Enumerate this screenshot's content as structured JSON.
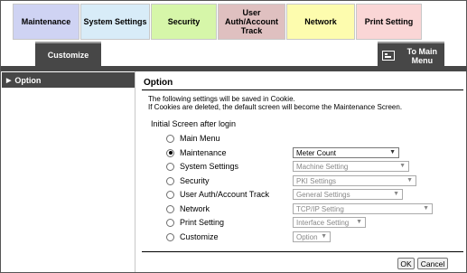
{
  "tabs": {
    "maintenance": "Maintenance",
    "system_settings": "System Settings",
    "security": "Security",
    "user_auth_line1": "User",
    "user_auth_line2": "Auth/Account",
    "user_auth_line3": "Track",
    "network": "Network",
    "print_setting": "Print Setting"
  },
  "subtab": {
    "customize": "Customize"
  },
  "main_menu": {
    "line1": "To Main",
    "line2": "Menu"
  },
  "leftnav": {
    "option": "Option"
  },
  "content": {
    "title": "Option",
    "note1": "The following settings will be saved in Cookie.",
    "note2": "If Cookies are deleted, the default screen will become the Maintenance Screen.",
    "section_label": "Initial Screen after login"
  },
  "options": [
    {
      "label": "Main Menu",
      "checked": false,
      "select": ""
    },
    {
      "label": "Maintenance",
      "checked": true,
      "select": "Meter Count"
    },
    {
      "label": "System Settings",
      "checked": false,
      "select": "Machine Setting"
    },
    {
      "label": "Security",
      "checked": false,
      "select": "PKI Settings"
    },
    {
      "label": "User Auth/Account Track",
      "checked": false,
      "select": "General Settings"
    },
    {
      "label": "Network",
      "checked": false,
      "select": "TCP/IP Setting"
    },
    {
      "label": "Print Setting",
      "checked": false,
      "select": "Interface Setting"
    },
    {
      "label": "Customize",
      "checked": false,
      "select": "Option"
    }
  ],
  "buttons": {
    "ok": "OK",
    "cancel": "Cancel"
  },
  "icons": {
    "main_menu": "main-menu-icon",
    "nav_arrow": "triangle-right-icon",
    "select_chevron": "chevron-down-icon"
  },
  "colors": {
    "maintenance_tab": "#cfd3f3",
    "system_tab": "#d8ecf8",
    "security_tab": "#d6f6a9",
    "user_tab": "#dfc0c0",
    "network_tab": "#fdfcae",
    "print_tab": "#fad6d6",
    "dark_bar": "#474747"
  }
}
